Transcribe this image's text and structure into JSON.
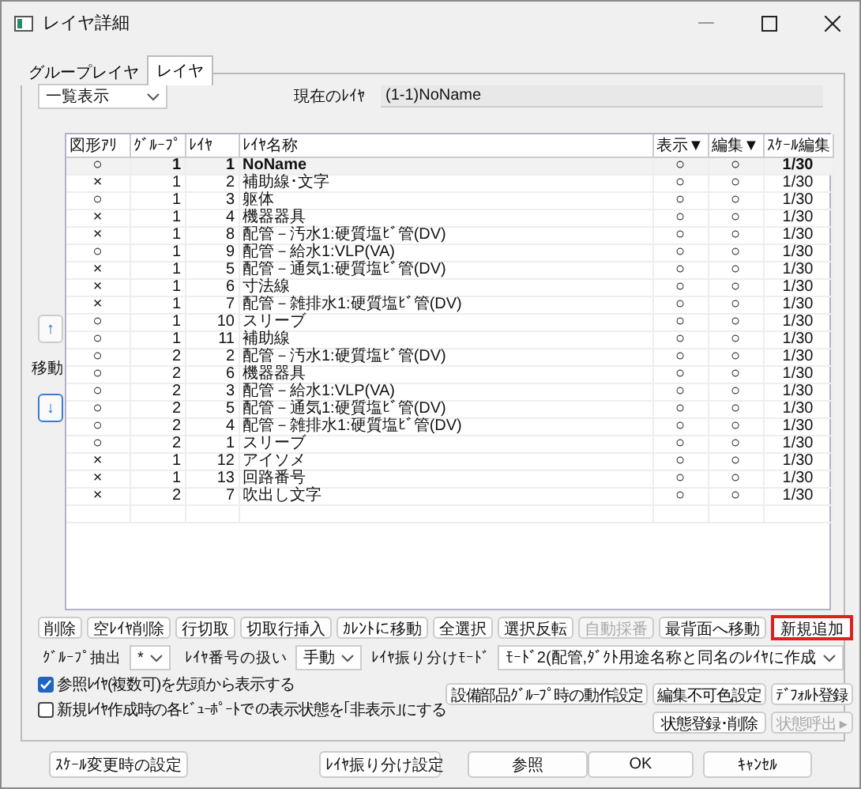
{
  "window": {
    "title": "レイヤ詳細"
  },
  "tabs": [
    {
      "label": "グループレイヤ",
      "selected": false
    },
    {
      "label": "レイヤ",
      "selected": true
    }
  ],
  "view_select": {
    "value": "一覧表示"
  },
  "current_layer": {
    "label": "現在のﾚｲﾔ",
    "value": "(1-1)NoName"
  },
  "move": {
    "label": "移動",
    "up": "↑",
    "down": "↓"
  },
  "table": {
    "columns": [
      "図形ｱﾘ",
      "ｸﾞﾙｰﾌﾟ",
      "ﾚｲﾔ",
      "ﾚｲﾔ名称",
      "表示▼",
      "編集▼",
      "ｽｹｰﾙ編集"
    ],
    "rows": [
      {
        "figure": "○",
        "group": "1",
        "layer": "1",
        "name": "NoName",
        "display": "○",
        "edit": "○",
        "scale": "1/30",
        "selected": true
      },
      {
        "figure": "×",
        "group": "1",
        "layer": "2",
        "name": "補助線･文字",
        "display": "○",
        "edit": "○",
        "scale": "1/30",
        "selected": false
      },
      {
        "figure": "○",
        "group": "1",
        "layer": "3",
        "name": "躯体",
        "display": "○",
        "edit": "○",
        "scale": "1/30",
        "selected": false
      },
      {
        "figure": "×",
        "group": "1",
        "layer": "4",
        "name": "機器器具",
        "display": "○",
        "edit": "○",
        "scale": "1/30",
        "selected": false
      },
      {
        "figure": "×",
        "group": "1",
        "layer": "8",
        "name": "配管－汚水1:硬質塩ﾋﾞ管(DV)",
        "display": "○",
        "edit": "○",
        "scale": "1/30",
        "selected": false
      },
      {
        "figure": "○",
        "group": "1",
        "layer": "9",
        "name": "配管－給水1:VLP(VA)",
        "display": "○",
        "edit": "○",
        "scale": "1/30",
        "selected": false
      },
      {
        "figure": "×",
        "group": "1",
        "layer": "5",
        "name": "配管－通気1:硬質塩ﾋﾞ管(DV)",
        "display": "○",
        "edit": "○",
        "scale": "1/30",
        "selected": false
      },
      {
        "figure": "×",
        "group": "1",
        "layer": "6",
        "name": "寸法線",
        "display": "○",
        "edit": "○",
        "scale": "1/30",
        "selected": false
      },
      {
        "figure": "×",
        "group": "1",
        "layer": "7",
        "name": "配管－雑排水1:硬質塩ﾋﾞ管(DV)",
        "display": "○",
        "edit": "○",
        "scale": "1/30",
        "selected": false
      },
      {
        "figure": "○",
        "group": "1",
        "layer": "10",
        "name": "スリーブ",
        "display": "○",
        "edit": "○",
        "scale": "1/30",
        "selected": false
      },
      {
        "figure": "○",
        "group": "1",
        "layer": "11",
        "name": "補助線",
        "display": "○",
        "edit": "○",
        "scale": "1/30",
        "selected": false
      },
      {
        "figure": "○",
        "group": "2",
        "layer": "2",
        "name": "配管－汚水1:硬質塩ﾋﾞ管(DV)",
        "display": "○",
        "edit": "○",
        "scale": "1/30",
        "selected": false
      },
      {
        "figure": "○",
        "group": "2",
        "layer": "6",
        "name": "機器器具",
        "display": "○",
        "edit": "○",
        "scale": "1/30",
        "selected": false
      },
      {
        "figure": "○",
        "group": "2",
        "layer": "3",
        "name": "配管－給水1:VLP(VA)",
        "display": "○",
        "edit": "○",
        "scale": "1/30",
        "selected": false
      },
      {
        "figure": "○",
        "group": "2",
        "layer": "5",
        "name": "配管－通気1:硬質塩ﾋﾞ管(DV)",
        "display": "○",
        "edit": "○",
        "scale": "1/30",
        "selected": false
      },
      {
        "figure": "○",
        "group": "2",
        "layer": "4",
        "name": "配管－雑排水1:硬質塩ﾋﾞ管(DV)",
        "display": "○",
        "edit": "○",
        "scale": "1/30",
        "selected": false
      },
      {
        "figure": "○",
        "group": "2",
        "layer": "1",
        "name": "スリーブ",
        "display": "○",
        "edit": "○",
        "scale": "1/30",
        "selected": false
      },
      {
        "figure": "×",
        "group": "1",
        "layer": "12",
        "name": "アイソメ",
        "display": "○",
        "edit": "○",
        "scale": "1/30",
        "selected": false
      },
      {
        "figure": "×",
        "group": "1",
        "layer": "13",
        "name": "回路番号",
        "display": "○",
        "edit": "○",
        "scale": "1/30",
        "selected": false
      },
      {
        "figure": "×",
        "group": "2",
        "layer": "7",
        "name": "吹出し文字",
        "display": "○",
        "edit": "○",
        "scale": "1/30",
        "selected": false
      }
    ]
  },
  "actions": [
    {
      "label": "削除",
      "disabled": false,
      "highlighted": false
    },
    {
      "label": "空ﾚｲﾔ削除",
      "disabled": false,
      "highlighted": false
    },
    {
      "label": "行切取",
      "disabled": false,
      "highlighted": false
    },
    {
      "label": "切取行挿入",
      "disabled": false,
      "highlighted": false
    },
    {
      "label": "ｶﾚﾝﾄに移動",
      "disabled": false,
      "highlighted": false
    },
    {
      "label": "全選択",
      "disabled": false,
      "highlighted": false
    },
    {
      "label": "選択反転",
      "disabled": false,
      "highlighted": false
    },
    {
      "label": "自動採番",
      "disabled": true,
      "highlighted": false
    },
    {
      "label": "最背面へ移動",
      "disabled": false,
      "highlighted": false
    },
    {
      "label": "新規追加",
      "disabled": false,
      "highlighted": true
    }
  ],
  "filters": [
    {
      "label": "ｸﾞﾙｰﾌﾟ抽出",
      "value": "*"
    },
    {
      "label": "ﾚｲﾔ番号の扱い",
      "value": "手動"
    },
    {
      "label": "ﾚｲﾔ振り分けﾓｰﾄﾞ",
      "value": "ﾓｰﾄﾞ2(配管,ﾀﾞｸﾄ用途名称と同名のﾚｲﾔに作成"
    }
  ],
  "checkboxes": [
    {
      "label": "参照ﾚｲﾔ(複数可)を先頭から表示する",
      "checked": true
    },
    {
      "label": "新規ﾚｲﾔ作成時の各ﾋﾞｭｰﾎﾟｰﾄでの表示状態を｢非表示｣にする",
      "checked": false
    }
  ],
  "settings_buttons": [
    {
      "label": "設備部品ｸﾞﾙｰﾌﾟ時の動作設定",
      "disabled": false
    },
    {
      "label": "編集不可色設定",
      "disabled": false
    },
    {
      "label": "ﾃﾞﾌｫﾙﾄ登録",
      "disabled": false
    },
    {
      "label": "状態登録･削除",
      "disabled": false
    },
    {
      "label": "状態呼出",
      "disabled": true,
      "menu_arrow": "▸"
    }
  ],
  "footer_buttons": [
    "ｽｹｰﾙ変更時の設定",
    "ﾚｲﾔ振り分け設定",
    "参照",
    "OK",
    "ｷｬﾝｾﾙ"
  ]
}
